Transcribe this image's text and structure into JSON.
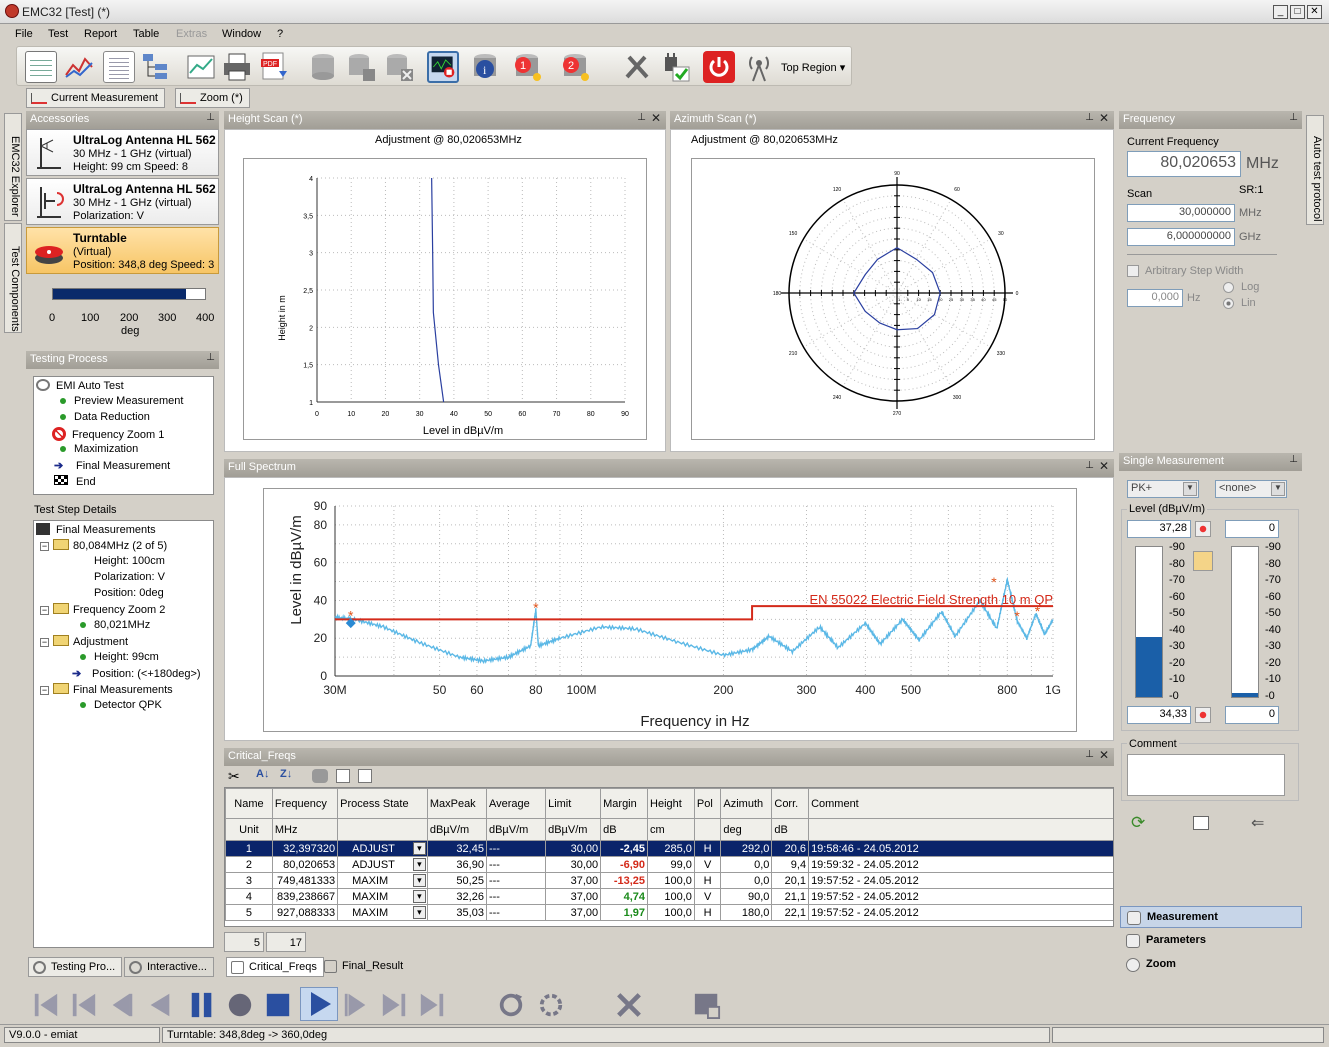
{
  "window": {
    "title": "EMC32 [Test] (*)",
    "minimize": "_",
    "maximize": "□",
    "close": "✕"
  },
  "menu": [
    "File",
    "Test",
    "Report",
    "Table",
    "Extras",
    "Window",
    "?"
  ],
  "toolbar": {
    "region": "Top Region",
    "icons": [
      "data-table-icon",
      "graph-icon",
      "report-icon",
      "tree-icon",
      "chart-icon",
      "print-icon",
      "pdf-export-icon",
      "database-icon",
      "database-save-icon",
      "database-close-icon",
      "monitor-stop-icon",
      "info-icon",
      "database-1-icon",
      "database-2-icon",
      "tools-icon",
      "plug-check-icon",
      "power-icon",
      "antenna-icon"
    ]
  },
  "subtabs": {
    "current": "Current Measurement",
    "zoom": "Zoom (*)"
  },
  "side_tabs": [
    "EMC32 Explorer",
    "Test Components"
  ],
  "right_side_tab": "Auto test protocol",
  "accessories": {
    "title": "Accessories",
    "items": [
      {
        "name": "UltraLog Antenna HL 562",
        "line2": "30 MHz - 1 GHz (virtual)",
        "line3": "Height: 99 cm Speed: 8"
      },
      {
        "name": "UltraLog Antenna HL 562",
        "line2": "30 MHz - 1 GHz (virtual)",
        "line3": "Polarization: V"
      },
      {
        "name": "Turntable",
        "line2": "(Virtual)",
        "line3": "Position: 348,8 deg Speed: 3"
      }
    ],
    "gauge": {
      "ticks": [
        "0",
        "100",
        "200",
        "300",
        "400"
      ],
      "unit": "deg",
      "value": 348.8,
      "max": 400
    }
  },
  "testing_process": {
    "title": "Testing Process",
    "steps": [
      {
        "label": "EMI Auto Test"
      },
      {
        "label": "Preview Measurement"
      },
      {
        "label": "Data Reduction"
      },
      {
        "label": "Frequency Zoom 1"
      },
      {
        "label": "Maximization"
      },
      {
        "label": "Final Measurement"
      },
      {
        "label": "End"
      }
    ]
  },
  "test_step_details": {
    "title": "Test Step Details",
    "items": [
      "Final Measurements",
      "80,084MHz (2 of 5)",
      "Height: 100cm",
      "Polarization: V",
      "Position: 0deg",
      "Frequency Zoom 2",
      "80,021MHz",
      "Adjustment",
      "Height: 99cm",
      "Position: (<+180deg>)",
      "Final Measurements",
      "Detector QPK"
    ]
  },
  "left_bottom_tabs": [
    "Testing Pro...",
    "Interactive..."
  ],
  "height_scan": {
    "title": "Height Scan (*)",
    "heading": "Adjustment @ 80,020653MHz",
    "ylabel": "Height in m",
    "xlabel": "Level in dBµV/m",
    "yticks": [
      "4",
      "3,5",
      "3",
      "2,5",
      "2",
      "1,5",
      "1"
    ],
    "xticks": [
      "0",
      "10",
      "20",
      "30",
      "40",
      "50",
      "60",
      "70",
      "80",
      "90"
    ]
  },
  "azimuth_scan": {
    "title": "Azimuth Scan (*)",
    "heading": "Adjustment @ 80,020653MHz",
    "angle_labels": [
      "90",
      "60",
      "120",
      "150",
      "30",
      "180",
      "0",
      "210",
      "330",
      "240",
      "300",
      "270"
    ],
    "radial_labels": [
      "1",
      "5",
      "10",
      "15",
      "20",
      "25",
      "30",
      "35",
      "40",
      "45",
      "50"
    ]
  },
  "full_spectrum": {
    "title": "Full Spectrum",
    "ylabel": "Level in dBµV/m",
    "xlabel": "Frequency in Hz",
    "limit_label": "EN 55022 Electric Field Strength 10 m QP",
    "yticks": [
      "90",
      "80",
      "60",
      "40",
      "20",
      "0"
    ],
    "xticks": [
      "30M",
      "50",
      "60",
      "80",
      "100M",
      "200",
      "300",
      "400",
      "500",
      "800",
      "1G"
    ]
  },
  "chart_data": [
    {
      "type": "line",
      "title": "Full Spectrum",
      "xlabel": "Frequency in Hz",
      "ylabel": "Level in dBµV/m",
      "x_scale": "log",
      "xlim": [
        30000000,
        1000000000
      ],
      "ylim": [
        0,
        90
      ],
      "grid": true,
      "series": [
        {
          "name": "EN 55022 Electric Field Strength 10 m QP",
          "points": [
            [
              30000000,
              30
            ],
            [
              230000000,
              30
            ],
            [
              230000000,
              37
            ],
            [
              1000000000,
              37
            ]
          ]
        },
        {
          "points": [
            [
              30000000,
              31
            ],
            [
              33000000,
              30
            ],
            [
              38000000,
              26
            ],
            [
              45000000,
              18
            ],
            [
              55000000,
              10
            ],
            [
              62000000,
              8
            ],
            [
              70000000,
              10
            ],
            [
              78000000,
              16
            ],
            [
              80000000,
              35
            ],
            [
              81000000,
              16
            ],
            [
              90000000,
              20
            ],
            [
              110000000,
              26
            ],
            [
              130000000,
              25
            ],
            [
              160000000,
              18
            ],
            [
              200000000,
              11
            ],
            [
              230000000,
              14
            ],
            [
              250000000,
              21
            ],
            [
              280000000,
              13
            ],
            [
              320000000,
              26
            ],
            [
              350000000,
              15
            ],
            [
              400000000,
              28
            ],
            [
              430000000,
              17
            ],
            [
              480000000,
              30
            ],
            [
              520000000,
              19
            ],
            [
              580000000,
              34
            ],
            [
              620000000,
              21
            ],
            [
              700000000,
              40
            ],
            [
              760000000,
              25
            ],
            [
              800000000,
              51
            ],
            [
              840000000,
              29
            ],
            [
              880000000,
              20
            ],
            [
              920000000,
              33
            ],
            [
              960000000,
              22
            ],
            [
              1000000000,
              30
            ]
          ]
        }
      ],
      "markers": [
        {
          "x": 32397320,
          "y": 32.45
        },
        {
          "x": 80020653,
          "y": 36.9
        },
        {
          "x": 749481333,
          "y": 50.25
        },
        {
          "x": 839238667,
          "y": 32.26
        },
        {
          "x": 927088333,
          "y": 35.03
        }
      ]
    },
    {
      "type": "line",
      "title": "Height Scan",
      "xlabel": "Level in dBµV/m",
      "ylabel": "Height in m",
      "xlim": [
        0,
        90
      ],
      "ylim": [
        1,
        4
      ],
      "grid": true,
      "series": [
        {
          "points": [
            [
              33.5,
              4
            ],
            [
              33.8,
              3
            ],
            [
              34,
              2.2
            ],
            [
              35.5,
              1.5
            ],
            [
              37,
              1
            ]
          ]
        }
      ]
    },
    {
      "type": "line",
      "title": "Azimuth Scan",
      "polar": true,
      "rlim": [
        0,
        50
      ],
      "series": [
        {
          "points": [
            [
              0,
              20
            ],
            [
              30,
              19
            ],
            [
              60,
              18
            ],
            [
              90,
              21
            ],
            [
              120,
              18
            ],
            [
              150,
              17
            ],
            [
              180,
              20
            ],
            [
              210,
              17
            ],
            [
              240,
              16
            ],
            [
              270,
              17
            ],
            [
              300,
              19
            ],
            [
              330,
              20
            ],
            [
              360,
              20
            ]
          ]
        }
      ]
    }
  ],
  "critical_freqs": {
    "title": "Critical_Freqs",
    "headers": [
      "Name",
      "Frequency",
      "Process State",
      "MaxPeak",
      "Average",
      "Limit",
      "Margin",
      "Height",
      "Pol",
      "Azimuth",
      "Corr.",
      "Comment"
    ],
    "units": [
      "Unit",
      "MHz",
      "",
      "dBµV/m",
      "dBµV/m",
      "dBµV/m",
      "dB",
      "cm",
      "",
      "deg",
      "dB",
      ""
    ],
    "rows": [
      [
        "1",
        "32,397320",
        "ADJUST",
        "32,45",
        "---",
        "30,00",
        "-2,45",
        "285,0",
        "H",
        "292,0",
        "20,6",
        "19:58:46 - 24.05.2012"
      ],
      [
        "2",
        "80,020653",
        "ADJUST",
        "36,90",
        "---",
        "30,00",
        "-6,90",
        "99,0",
        "V",
        "0,0",
        "9,4",
        "19:59:32 - 24.05.2012"
      ],
      [
        "3",
        "749,481333",
        "MAXIM",
        "50,25",
        "---",
        "37,00",
        "-13,25",
        "100,0",
        "H",
        "0,0",
        "20,1",
        "19:57:52 - 24.05.2012"
      ],
      [
        "4",
        "839,238667",
        "MAXIM",
        "32,26",
        "---",
        "37,00",
        "4,74",
        "100,0",
        "V",
        "90,0",
        "21,1",
        "19:57:52 - 24.05.2012"
      ],
      [
        "5",
        "927,088333",
        "MAXIM",
        "35,03",
        "---",
        "37,00",
        "1,97",
        "100,0",
        "H",
        "180,0",
        "22,1",
        "19:57:52 - 24.05.2012"
      ]
    ],
    "footer": [
      "5",
      "17"
    ]
  },
  "bottom_tabs": [
    "Critical_Freqs",
    "Final_Result"
  ],
  "frequency": {
    "title": "Frequency",
    "current_label": "Current Frequency",
    "current_value": "80,020653",
    "current_unit": "MHz",
    "scan_label": "Scan",
    "sr_label": "SR:1",
    "scan_from": "30,000000",
    "scan_from_unit": "MHz",
    "scan_step": "6,000000000",
    "scan_step_unit": "GHz",
    "arb_label": "Arbitrary Step Width",
    "arb_value": "0,000",
    "arb_unit": "Hz",
    "log": "Log",
    "lin": "Lin"
  },
  "single_measurement": {
    "title": "Single Measurement",
    "detector": "PK+",
    "second": "<none>",
    "level_label": "Level (dBµV/m)",
    "value_top": "37,28",
    "value_right": "0",
    "value_bottom": "34,33",
    "value_bottom_right": "0",
    "scale": [
      "90",
      "80",
      "70",
      "60",
      "50",
      "40",
      "30",
      "20",
      "10",
      "0"
    ],
    "bar_value": 36,
    "bar_max": 90,
    "comment_label": "Comment"
  },
  "nav": {
    "measurement": "Measurement",
    "parameters": "Parameters",
    "zoom": "Zoom"
  },
  "status": {
    "version": "V9.0.0 - emiat",
    "message": "Turntable: 348,8deg -> 360,0deg"
  },
  "colors": {
    "accent": "#0a246a",
    "spectrum": "#5bb8e6",
    "limit": "#d42a1a",
    "turntable": "#ffd27f"
  }
}
